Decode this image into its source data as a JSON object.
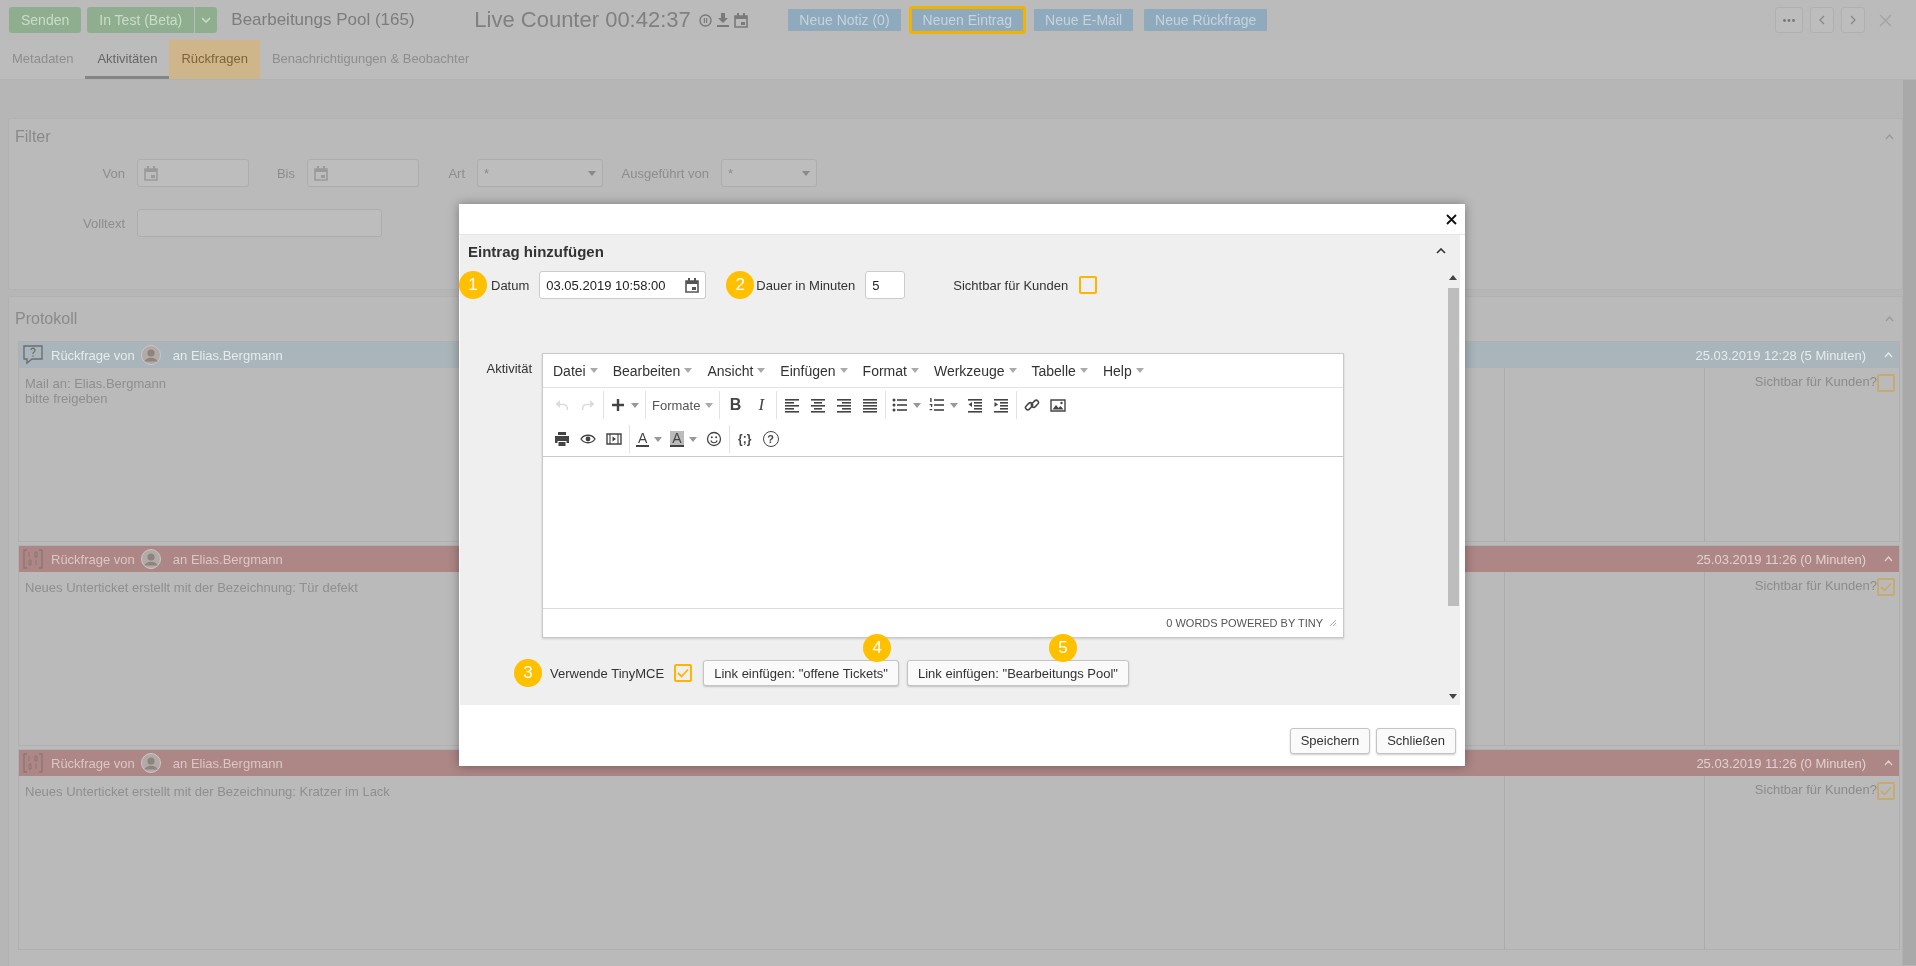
{
  "toolbar": {
    "buttons": [
      {
        "label": "Senden",
        "kind": "plain"
      },
      {
        "label": "In Test (Beta)",
        "kind": "split"
      }
    ],
    "title": "Bearbeitungs Pool (165)",
    "counter": "Live Counter 00:42:37",
    "actions": [
      {
        "label": "Neue Notiz (0)",
        "highlighted": false
      },
      {
        "label": "Neuen Eintrag",
        "highlighted": true
      },
      {
        "label": "Neue E-Mail",
        "highlighted": false
      },
      {
        "label": "Neue Rückfrage",
        "highlighted": false
      }
    ]
  },
  "tabs": [
    {
      "label": "Metadaten",
      "selected": false,
      "highlighted": false
    },
    {
      "label": "Aktivitäten",
      "selected": true,
      "highlighted": false
    },
    {
      "label": "Rückfragen",
      "selected": false,
      "highlighted": true
    },
    {
      "label": "Benachrichtigungen & Beobachter",
      "selected": false,
      "highlighted": false
    }
  ],
  "filter": {
    "title": "Filter",
    "fields": [
      {
        "label": "Von",
        "kind": "date"
      },
      {
        "label": "Bis",
        "kind": "date"
      },
      {
        "label": "Art",
        "kind": "select",
        "value": "*"
      },
      {
        "label": "Ausgeführt von",
        "kind": "select",
        "value": "*"
      },
      {
        "label": "Volltext",
        "kind": "text"
      }
    ]
  },
  "protokoll": {
    "title": "Protokoll",
    "entries": [
      {
        "kind": "question",
        "from": "Rückfrage von",
        "to": "an Elias.Bergmann",
        "date": "25.03.2019 12:28 (5 Minuten)",
        "lines": [
          "Mail an: Elias.Bergmann",
          "bitte freigeben"
        ],
        "visible_label": "Sichtbar für Kunden?",
        "visible": false
      },
      {
        "kind": "subticket",
        "from": "Rückfrage von",
        "to": "an Elias.Bergmann",
        "date": "25.03.2019 11:26 (0 Minuten)",
        "lines": [
          "Neues Unterticket erstellt mit der Bezeichnung: Tür defekt"
        ],
        "visible_label": "Sichtbar für Kunden?",
        "visible": true
      },
      {
        "kind": "subticket",
        "from": "Rückfrage von",
        "to": "an Elias.Bergmann",
        "date": "25.03.2019 11:26 (0 Minuten)",
        "lines": [
          "Neues Unterticket erstellt mit der Bezeichnung: Kratzer im Lack"
        ],
        "visible_label": "Sichtbar für Kunden?",
        "visible": true
      }
    ]
  },
  "dialog": {
    "title": "Eintrag hinzufügen",
    "fields": [
      {
        "kind": "date",
        "badge": "1",
        "label": "Datum",
        "value": "03.05.2019 10:58:00"
      },
      {
        "kind": "number",
        "badge": "2",
        "label": "Dauer in Minuten",
        "value": "5"
      },
      {
        "kind": "checkbox",
        "label": "Sichtbar für Kunden",
        "checked": false
      }
    ],
    "editor": {
      "label": "Aktivität",
      "menu": [
        "Datei",
        "Bearbeiten",
        "Ansicht",
        "Einfügen",
        "Format",
        "Werkzeuge",
        "Tabelle",
        "Help"
      ],
      "toolbar": [
        [
          [
            {
              "kind": "undo",
              "disabled": true
            },
            {
              "kind": "redo",
              "disabled": true
            }
          ],
          [
            {
              "kind": "insert",
              "disabled": false
            }
          ],
          [
            {
              "kind": "formats",
              "label": "Formate",
              "disabled": false
            }
          ],
          [
            {
              "kind": "bold",
              "label": "B",
              "disabled": false
            },
            {
              "kind": "italic",
              "label": "I",
              "disabled": false
            }
          ],
          [
            {
              "kind": "alignleft",
              "disabled": false
            },
            {
              "kind": "aligncenter",
              "disabled": false
            },
            {
              "kind": "alignright",
              "disabled": false
            },
            {
              "kind": "alignjustify",
              "disabled": false
            }
          ],
          [
            {
              "kind": "bullist",
              "disabled": false
            },
            {
              "kind": "numlist",
              "disabled": false
            },
            {
              "kind": "outdent",
              "disabled": false
            },
            {
              "kind": "indent",
              "disabled": false
            }
          ],
          [
            {
              "kind": "link",
              "disabled": false
            },
            {
              "kind": "image",
              "disabled": false
            }
          ]
        ],
        [
          [
            {
              "kind": "print",
              "disabled": false
            },
            {
              "kind": "preview",
              "disabled": false
            },
            {
              "kind": "media",
              "disabled": false
            }
          ],
          [
            {
              "kind": "forecolor",
              "label": "A",
              "disabled": false
            },
            {
              "kind": "backcolor",
              "label": "A",
              "disabled": false
            },
            {
              "kind": "emoticons",
              "disabled": false
            }
          ],
          [
            {
              "kind": "codesample",
              "label": "{;}",
              "disabled": false
            },
            {
              "kind": "help",
              "label": "?",
              "disabled": false
            }
          ]
        ]
      ],
      "status": "0 WORDS POWERED BY TINY"
    },
    "tinymce": {
      "badge": "3",
      "label": "Verwende TinyMCE",
      "checked": true
    },
    "link_buttons": [
      {
        "badge": "4",
        "label": "Link einfügen: \"offene Tickets\""
      },
      {
        "badge": "5",
        "label": "Link einfügen: \"Bearbeitungs Pool\""
      }
    ],
    "buttons": [
      "Speichern",
      "Schließen"
    ]
  }
}
